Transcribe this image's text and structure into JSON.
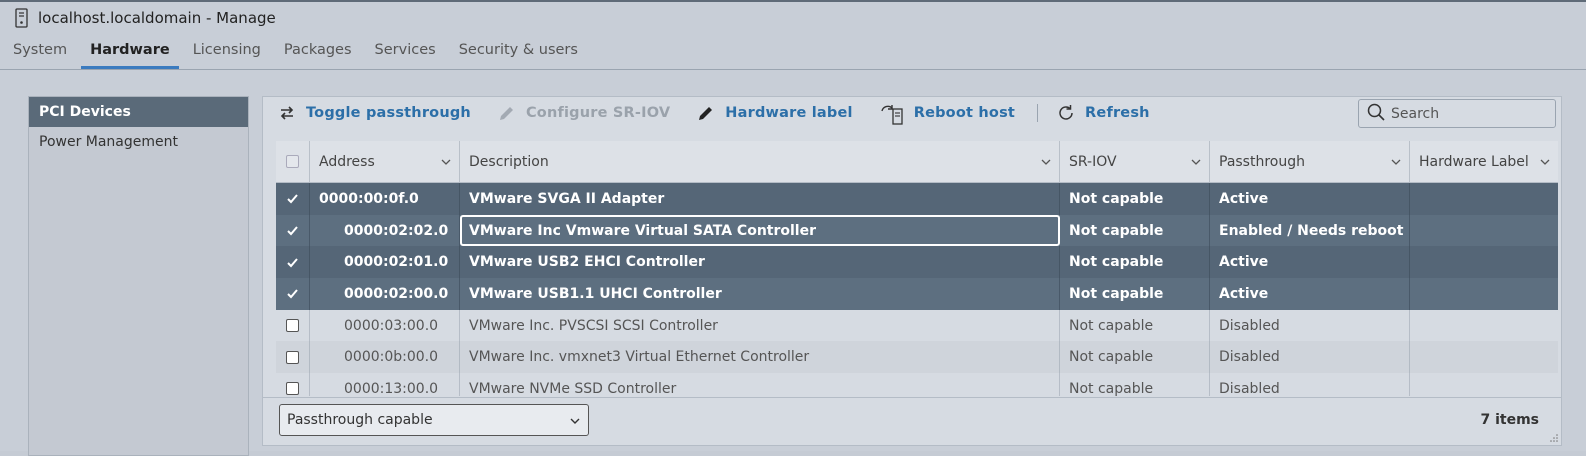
{
  "window": {
    "title": "localhost.localdomain - Manage"
  },
  "tabs": [
    {
      "label": "System"
    },
    {
      "label": "Hardware"
    },
    {
      "label": "Licensing"
    },
    {
      "label": "Packages"
    },
    {
      "label": "Services"
    },
    {
      "label": "Security & users"
    }
  ],
  "sidebar": {
    "items": [
      {
        "label": "PCI Devices"
      },
      {
        "label": "Power Management"
      }
    ]
  },
  "toolbar": {
    "toggle_passthrough": "Toggle passthrough",
    "configure_sriov": "Configure SR-IOV",
    "hardware_label": "Hardware label",
    "reboot_host": "Reboot host",
    "refresh": "Refresh",
    "search_placeholder": "Search"
  },
  "table": {
    "columns": [
      "Address",
      "Description",
      "SR-IOV",
      "Passthrough",
      "Hardware Label"
    ],
    "rows": [
      {
        "selected": true,
        "address": "0000:00:0f.0",
        "description": "VMware SVGA II Adapter",
        "sriov": "Not capable",
        "passthrough": "Active",
        "label": ""
      },
      {
        "selected": true,
        "address": "0000:02:02.0",
        "description": "VMware Inc Vmware Virtual SATA Controller",
        "sriov": "Not capable",
        "passthrough": "Enabled / Needs reboot",
        "label": ""
      },
      {
        "selected": true,
        "address": "0000:02:01.0",
        "description": "VMware USB2 EHCI Controller",
        "sriov": "Not capable",
        "passthrough": "Active",
        "label": ""
      },
      {
        "selected": true,
        "address": "0000:02:00.0",
        "description": "VMware USB1.1 UHCI Controller",
        "sriov": "Not capable",
        "passthrough": "Active",
        "label": ""
      },
      {
        "selected": false,
        "address": "0000:03:00.0",
        "description": "VMware Inc. PVSCSI SCSI Controller",
        "sriov": "Not capable",
        "passthrough": "Disabled",
        "label": ""
      },
      {
        "selected": false,
        "address": "0000:0b:00.0",
        "description": "VMware Inc. vmxnet3 Virtual Ethernet Controller",
        "sriov": "Not capable",
        "passthrough": "Disabled",
        "label": ""
      },
      {
        "selected": false,
        "address": "0000:13:00.0",
        "description": "VMware NVMe SSD Controller",
        "sriov": "Not capable",
        "passthrough": "Disabled",
        "label": ""
      }
    ]
  },
  "footer": {
    "filter_value": "Passthrough capable",
    "count": "7 items"
  },
  "colors": {
    "accent": "#2c6fa8",
    "selected_row": "#556677",
    "tab_underline": "#3b7bbf"
  }
}
